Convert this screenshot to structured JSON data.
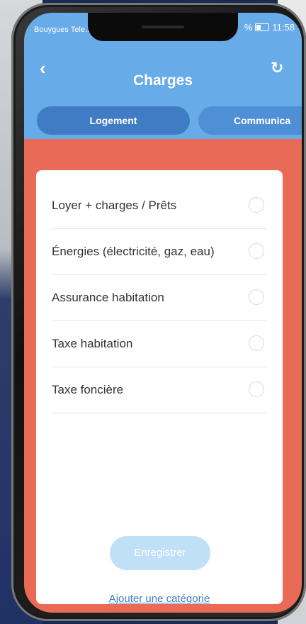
{
  "status_bar": {
    "carrier": "Bouygues Tele...",
    "battery_text": "%",
    "time": "11:58"
  },
  "header": {
    "title": "Charges",
    "back_icon": "chevron-left-icon",
    "refresh_icon": "refresh-icon"
  },
  "tabs": [
    {
      "label": "Logement",
      "active": true
    },
    {
      "label": "Communica",
      "active": false
    }
  ],
  "items": [
    {
      "label": "Loyer + charges / Prêts",
      "selected": false
    },
    {
      "label": "Énergies (électricité, gaz, eau)",
      "selected": false
    },
    {
      "label": "Assurance habitation",
      "selected": false
    },
    {
      "label": "Taxe habitation",
      "selected": false
    },
    {
      "label": "Taxe foncière",
      "selected": false
    }
  ],
  "actions": {
    "save_label": "Enregistrer",
    "add_category_label": "Ajouter une catégorie"
  },
  "colors": {
    "header_blue": "#67abe9",
    "tab_active_blue": "#3f7cc4",
    "background_coral": "#e96a56",
    "save_button_disabled": "#bfe0f7"
  }
}
